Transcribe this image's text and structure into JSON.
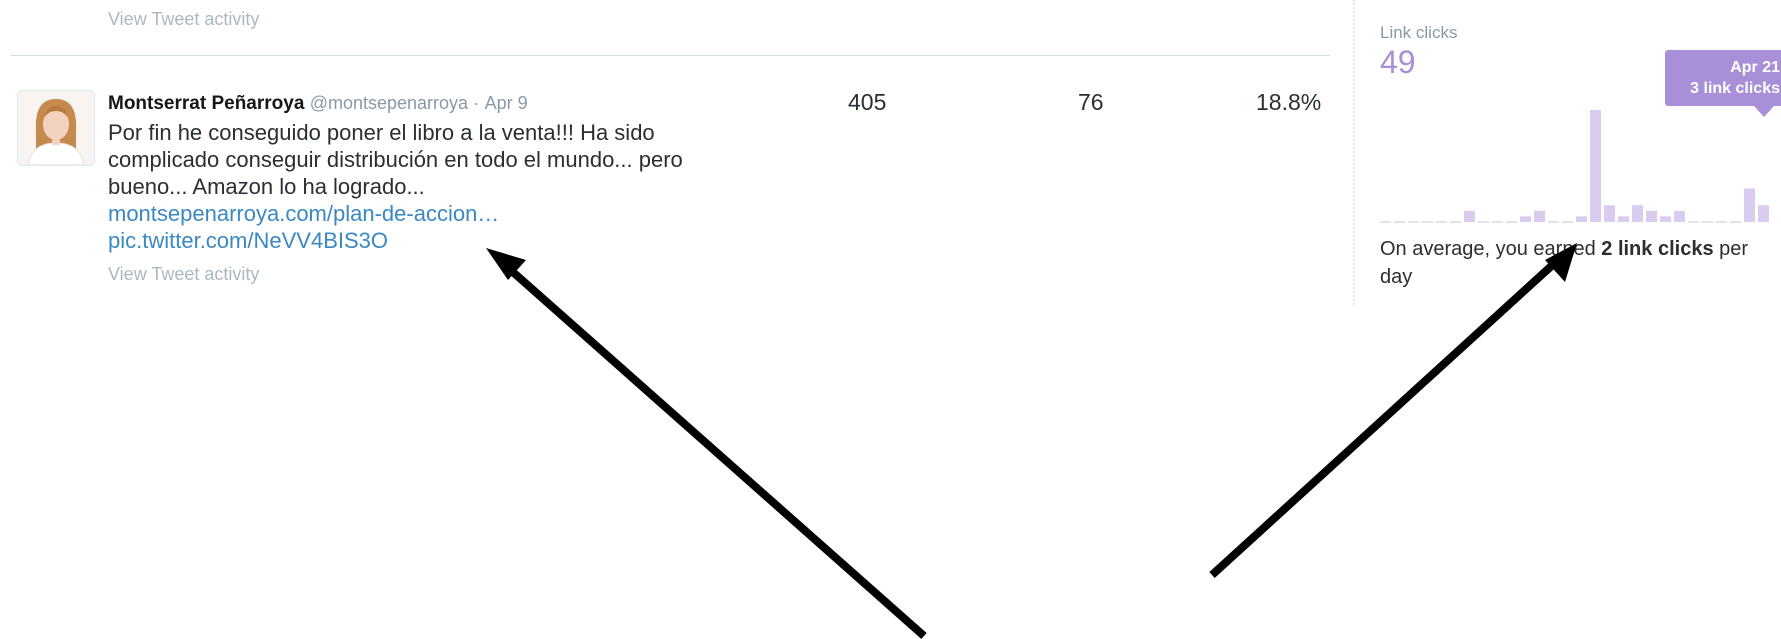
{
  "previous_row": {
    "view_activity_label": "View Tweet activity"
  },
  "tweet": {
    "author_name": "Montserrat Peñarroya",
    "author_handle": "@montsepenarroya",
    "separator": "·",
    "date": "Apr 9",
    "text": "Por fin he conseguido poner el libro a la venta!!! Ha sido complicado conseguir distribución en todo el mundo... pero bueno... Amazon lo ha logrado...",
    "link": "montsepenarroya.com/plan-de-accion…",
    "pic_link": "pic.twitter.com/NeVV4BIS3O",
    "view_activity_label": "View Tweet activity"
  },
  "stats": {
    "impressions": "405",
    "engagements": "76",
    "engagement_rate": "18.8%"
  },
  "link_clicks_panel": {
    "title": "Link clicks",
    "total": "49",
    "tooltip_date": "Apr 21",
    "tooltip_value": "3 link clicks",
    "summary_prefix": "On average, you earned",
    "summary_bold": "2 link clicks",
    "summary_suffix": "per day",
    "bar_color": "#d9ccf0",
    "accent_color": "#a98fd8",
    "daily_link_clicks": [
      0,
      0,
      0,
      0,
      0,
      0,
      1,
      0,
      0,
      0,
      0.5,
      1,
      0,
      0,
      0.5,
      10,
      1.5,
      0.5,
      1.5,
      1,
      0.5,
      1,
      0,
      0,
      0,
      0,
      3,
      1.5
    ]
  },
  "annotations": {
    "arrow_color": "#000000"
  }
}
